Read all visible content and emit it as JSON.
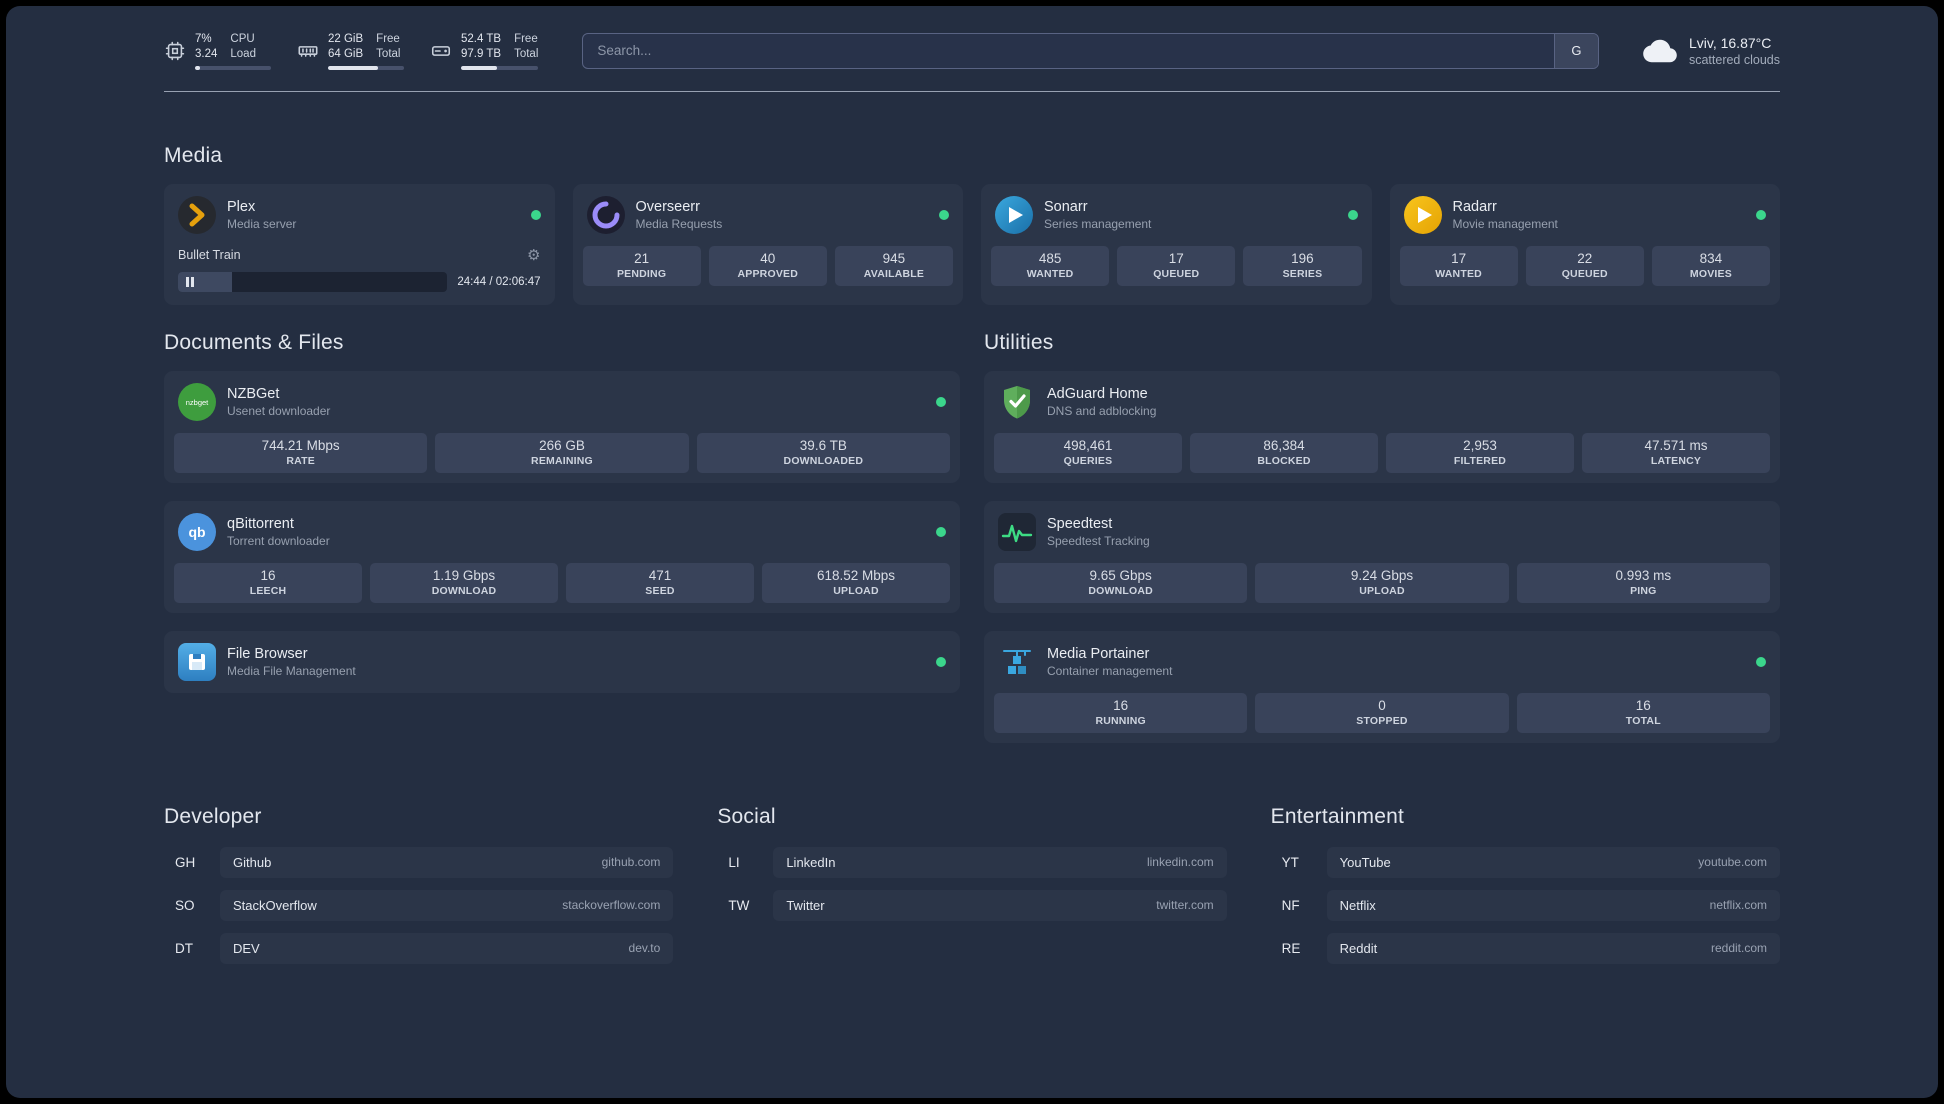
{
  "colors": {
    "background": "#242e41",
    "card": "#2b3548",
    "stat_block": "#39435a",
    "status_online": "#3bd68c",
    "text_primary": "#e3e7ee",
    "text_muted": "#97a0af",
    "plex_accent": "#e5a00d",
    "adguard_green": "#5fae5c",
    "speedtest_green": "#3ddc84",
    "portainer_blue": "#3aa7e0"
  },
  "top_bar": {
    "resources": [
      {
        "icon": "cpu-icon",
        "values": [
          "7%",
          "3.24"
        ],
        "labels": [
          "CPU",
          "Load"
        ],
        "bar_percent": 7
      },
      {
        "icon": "memory-icon",
        "values": [
          "22 GiB",
          "64 GiB"
        ],
        "labels": [
          "Free",
          "Total"
        ],
        "bar_percent": 66
      },
      {
        "icon": "disk-icon",
        "values": [
          "52.4 TB",
          "97.9 TB"
        ],
        "labels": [
          "Free",
          "Total"
        ],
        "bar_percent": 47
      }
    ],
    "search": {
      "placeholder": "Search...",
      "provider_label": "G"
    },
    "weather": {
      "icon": "cloud-icon",
      "location": "Lviv, 16.87°C",
      "condition": "scattered clouds"
    }
  },
  "groups": [
    {
      "title": "Media",
      "services": [
        {
          "name": "Plex",
          "subtitle": "Media server",
          "icon": "plex-icon",
          "status": "online",
          "player": {
            "title": "Bullet Train",
            "time": "24:44 / 02:06:47",
            "progress_percent": 20
          }
        },
        {
          "name": "Overseerr",
          "subtitle": "Media Requests",
          "icon": "overseerr-icon",
          "status": "online",
          "stats": [
            {
              "value": "21",
              "label": "PENDING"
            },
            {
              "value": "40",
              "label": "APPROVED"
            },
            {
              "value": "945",
              "label": "AVAILABLE"
            }
          ]
        },
        {
          "name": "Sonarr",
          "subtitle": "Series management",
          "icon": "sonarr-icon",
          "status": "online",
          "stats": [
            {
              "value": "485",
              "label": "WANTED"
            },
            {
              "value": "17",
              "label": "QUEUED"
            },
            {
              "value": "196",
              "label": "SERIES"
            }
          ]
        },
        {
          "name": "Radarr",
          "subtitle": "Movie management",
          "icon": "radarr-icon",
          "status": "online",
          "stats": [
            {
              "value": "17",
              "label": "WANTED"
            },
            {
              "value": "22",
              "label": "QUEUED"
            },
            {
              "value": "834",
              "label": "MOVIES"
            }
          ]
        }
      ]
    },
    {
      "title": "Documents & Files",
      "services": [
        {
          "name": "NZBGet",
          "subtitle": "Usenet downloader",
          "icon": "nzbget-icon",
          "status": "online",
          "stats": [
            {
              "value": "744.21 Mbps",
              "label": "RATE"
            },
            {
              "value": "266 GB",
              "label": "REMAINING"
            },
            {
              "value": "39.6 TB",
              "label": "DOWNLOADED"
            }
          ]
        },
        {
          "name": "qBittorrent",
          "subtitle": "Torrent downloader",
          "icon": "qbittorrent-icon",
          "status": "online",
          "stats": [
            {
              "value": "16",
              "label": "LEECH"
            },
            {
              "value": "1.19 Gbps",
              "label": "DOWNLOAD"
            },
            {
              "value": "471",
              "label": "SEED"
            },
            {
              "value": "618.52 Mbps",
              "label": "UPLOAD"
            }
          ]
        },
        {
          "name": "File Browser",
          "subtitle": "Media File Management",
          "icon": "filebrowser-icon",
          "status": "online",
          "stats": []
        }
      ]
    },
    {
      "title": "Utilities",
      "services": [
        {
          "name": "AdGuard Home",
          "subtitle": "DNS and adblocking",
          "icon": "adguard-icon",
          "status": "none",
          "stats": [
            {
              "value": "498,461",
              "label": "QUERIES"
            },
            {
              "value": "86,384",
              "label": "BLOCKED"
            },
            {
              "value": "2,953",
              "label": "FILTERED"
            },
            {
              "value": "47.571 ms",
              "label": "LATENCY"
            }
          ]
        },
        {
          "name": "Speedtest",
          "subtitle": "Speedtest Tracking",
          "icon": "speedtest-icon",
          "status": "none",
          "stats": [
            {
              "value": "9.65 Gbps",
              "label": "DOWNLOAD"
            },
            {
              "value": "9.24 Gbps",
              "label": "UPLOAD"
            },
            {
              "value": "0.993 ms",
              "label": "PING"
            }
          ]
        },
        {
          "name": "Media Portainer",
          "subtitle": "Container management",
          "icon": "portainer-icon",
          "status": "online",
          "stats": [
            {
              "value": "16",
              "label": "RUNNING"
            },
            {
              "value": "0",
              "label": "STOPPED"
            },
            {
              "value": "16",
              "label": "TOTAL"
            }
          ]
        }
      ]
    }
  ],
  "bookmarks": [
    {
      "title": "Developer",
      "items": [
        {
          "abbr": "GH",
          "name": "Github",
          "url": "github.com"
        },
        {
          "abbr": "SO",
          "name": "StackOverflow",
          "url": "stackoverflow.com"
        },
        {
          "abbr": "DT",
          "name": "DEV",
          "url": "dev.to"
        }
      ]
    },
    {
      "title": "Social",
      "items": [
        {
          "abbr": "LI",
          "name": "LinkedIn",
          "url": "linkedin.com"
        },
        {
          "abbr": "TW",
          "name": "Twitter",
          "url": "twitter.com"
        }
      ]
    },
    {
      "title": "Entertainment",
      "items": [
        {
          "abbr": "YT",
          "name": "YouTube",
          "url": "youtube.com"
        },
        {
          "abbr": "NF",
          "name": "Netflix",
          "url": "netflix.com"
        },
        {
          "abbr": "RE",
          "name": "Reddit",
          "url": "reddit.com"
        }
      ]
    }
  ]
}
